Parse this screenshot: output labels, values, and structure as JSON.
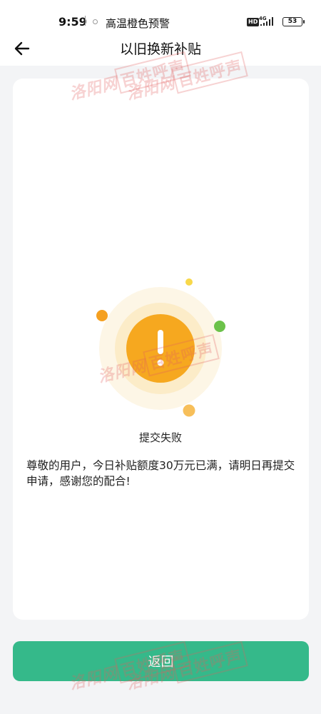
{
  "status_bar": {
    "time": "9:59",
    "alert": "高温橙色预警",
    "hd": "HD",
    "network": "4G",
    "battery": "53"
  },
  "nav": {
    "title": "以旧换新补贴",
    "back_icon": "arrow-left-icon"
  },
  "result": {
    "icon": "warning-exclamation-icon",
    "title": "提交失败",
    "message": "尊敬的用户，今日补贴额度30万元已满，请明日再提交申请，感谢您的配合!"
  },
  "actions": {
    "return_label": "返回"
  },
  "watermark": {
    "site": "洛阳网",
    "column": "百姓呼声"
  },
  "colors": {
    "primary": "#35b98a",
    "warning": "#f6a81f",
    "warning_light": "#fdf0d6",
    "accent_green": "#6cc24a",
    "background": "#f3f4f6"
  }
}
